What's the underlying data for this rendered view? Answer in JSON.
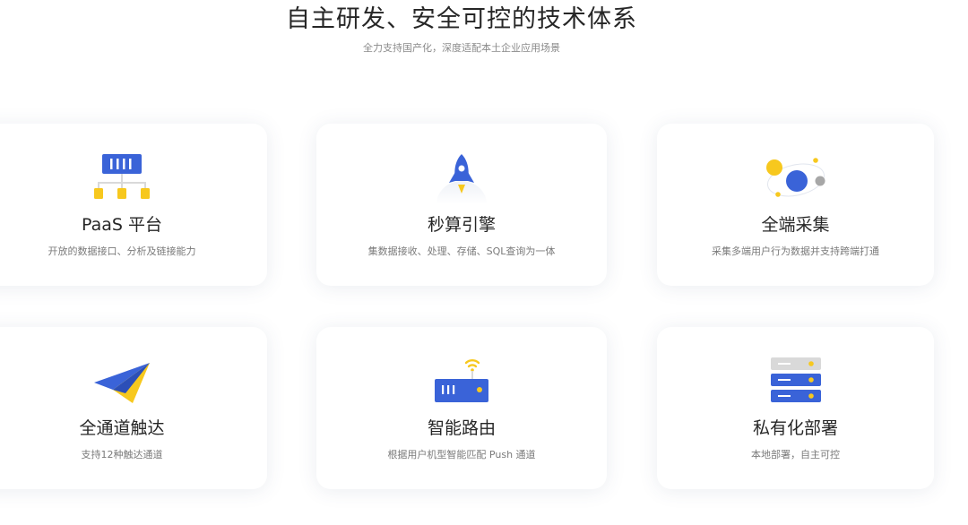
{
  "header": {
    "title": "自主研发、安全可控的技术体系",
    "subtitle": "全力支持国产化，深度适配本土企业应用场景"
  },
  "colors": {
    "primary_blue": "#3a63d8",
    "accent_yellow": "#f7c81e",
    "gray": "#a7a7a7"
  },
  "cards": [
    {
      "title": "PaaS 平台",
      "desc": "开放的数据接口、分析及链接能力",
      "icon": "platform-hierarchy-icon"
    },
    {
      "title": "秒算引擎",
      "desc": "集数据接收、处理、存储、SQL查询为一体",
      "icon": "rocket-icon"
    },
    {
      "title": "全端采集",
      "desc": "采集多端用户行为数据并支持跨端打通",
      "icon": "orbit-icon"
    },
    {
      "title": "全通道触达",
      "desc": "支持12种触达通道",
      "icon": "paper-plane-icon"
    },
    {
      "title": "智能路由",
      "desc": "根据用户机型智能匹配 Push 通道",
      "icon": "router-icon"
    },
    {
      "title": "私有化部署",
      "desc": "本地部署，自主可控",
      "icon": "server-rack-icon"
    }
  ]
}
